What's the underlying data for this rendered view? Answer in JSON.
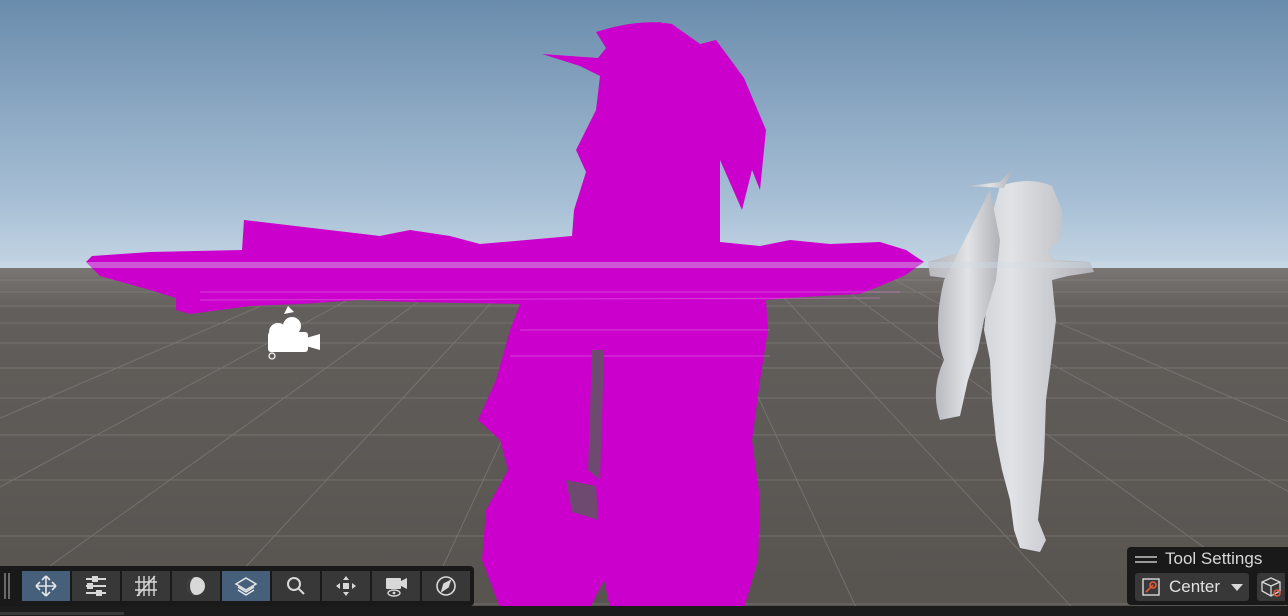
{
  "viewport": {
    "sky_top": "#6f8fae",
    "sky_horizon": "#bcd0e2",
    "ground": "#5a5653",
    "missing_material_color": "#cc00cc",
    "character_color": "#c8cad0"
  },
  "toolbar": {
    "tools": [
      {
        "name": "move-tool",
        "icon": "move-arrows-icon",
        "active": true
      },
      {
        "name": "sliders-tool",
        "icon": "sliders-icon",
        "active": false
      },
      {
        "name": "grid-snap-tool",
        "icon": "grid-snap-icon",
        "active": false
      },
      {
        "name": "shading-mode-tool",
        "icon": "shading-sphere-icon",
        "active": false
      },
      {
        "name": "layers-tool",
        "icon": "layers-icon",
        "active": true
      },
      {
        "name": "search-tool",
        "icon": "search-icon",
        "active": false
      },
      {
        "name": "gizmo-tool",
        "icon": "move-gizmo-icon",
        "active": false
      },
      {
        "name": "camera-view-tool",
        "icon": "camera-eye-icon",
        "active": false
      },
      {
        "name": "compass-tool",
        "icon": "compass-icon",
        "active": false
      }
    ]
  },
  "tool_settings": {
    "title": "Tool Settings",
    "pivot_mode": "Center",
    "pivot_icon": "pivot-center-icon",
    "space_icon": "global-space-cube-icon"
  }
}
